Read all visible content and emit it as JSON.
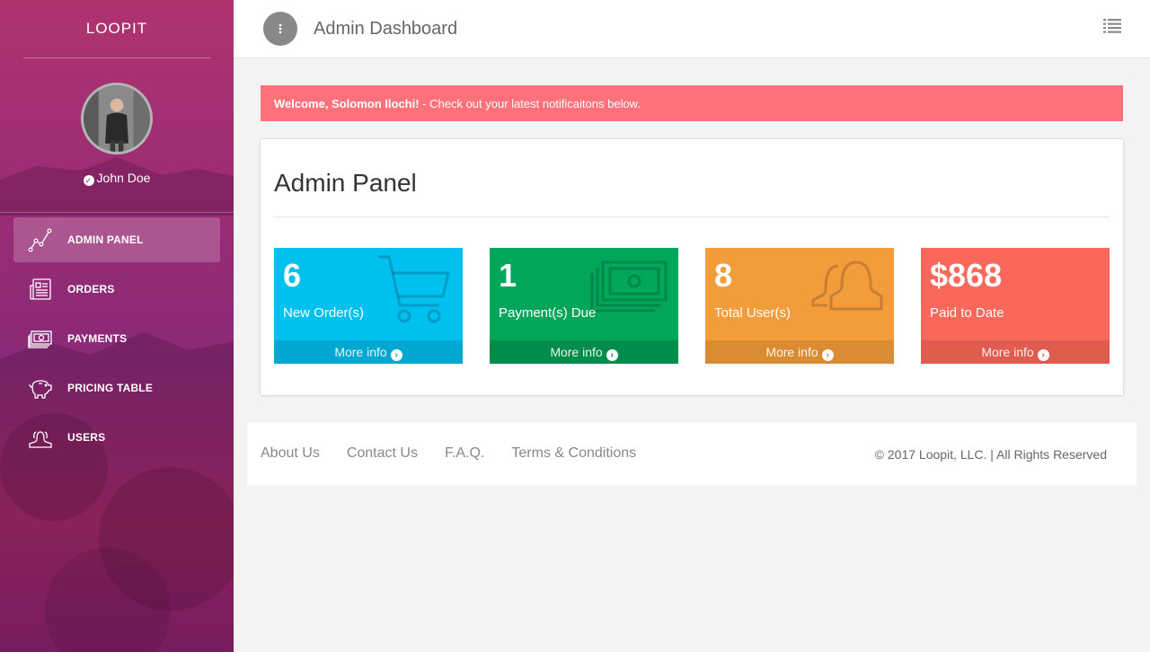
{
  "sidebar": {
    "brand": "LOOPIT",
    "user": {
      "name": "John Doe",
      "verified_icon": "check-circle-icon"
    },
    "items": [
      {
        "label": "ADMIN PANEL",
        "icon": "line-chart-icon",
        "active": true
      },
      {
        "label": "ORDERS",
        "icon": "newspaper-icon",
        "active": false
      },
      {
        "label": "PAYMENTS",
        "icon": "money-icon",
        "active": false
      },
      {
        "label": "PRICING TABLE",
        "icon": "piggy-bank-icon",
        "active": false
      },
      {
        "label": "USERS",
        "icon": "users-icon",
        "active": false
      }
    ]
  },
  "header": {
    "title": "Admin Dashboard",
    "menu_icon": "ellipsis-vertical-icon",
    "list_icon": "list-icon"
  },
  "alert": {
    "bold": "Welcome, Solomon Ilochi!",
    "text": " - Check out your latest notificaitons below.",
    "color": "#ff717a"
  },
  "panel": {
    "title": "Admin Panel",
    "boxes": [
      {
        "value": "6",
        "label": "New Order(s)",
        "link": "More info",
        "icon": "shopping-cart-icon",
        "color": "#00c0ef",
        "footer_color": "#00a7d0"
      },
      {
        "value": "1",
        "label": "Payment(s) Due",
        "link": "More info",
        "icon": "money-icon",
        "color": "#00a65a",
        "footer_color": "#008d4c"
      },
      {
        "value": "8",
        "label": "Total User(s)",
        "link": "More info",
        "icon": "users-icon",
        "color": "#f39c3c",
        "footer_color": "#db8b32"
      },
      {
        "value": "$868",
        "label": "Paid to Date",
        "link": "More info",
        "icon": "none",
        "color": "#f9685a",
        "footer_color": "#e05c4f"
      }
    ]
  },
  "footer": {
    "links": [
      "About Us",
      "Contact Us",
      "F.A.Q.",
      "Terms & Conditions"
    ],
    "copyright": "© 2017 Loopit, LLC. | All Rights Reserved"
  }
}
